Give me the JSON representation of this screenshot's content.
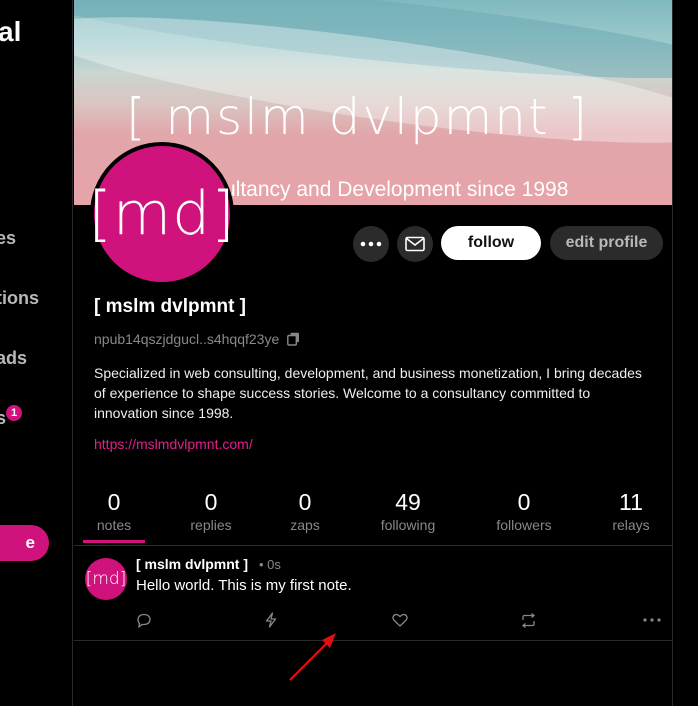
{
  "sidebar": {
    "logo_partial": "al",
    "items": [
      {
        "label": "es"
      },
      {
        "label": "tions"
      },
      {
        "label": "ads"
      },
      {
        "label": "s"
      }
    ],
    "badge_count": "1",
    "post_button_label": "e"
  },
  "banner": {
    "title": "[ mslm dvlpmnt ]",
    "subtitle": "ultancy and Development since 1998"
  },
  "avatar_text": "[md]",
  "actions": {
    "follow_label": "follow",
    "edit_label": "edit profile"
  },
  "profile": {
    "name": "[ mslm dvlpmnt ]",
    "npub": "npub14qszjdgucl..s4hqqf23ye",
    "bio": "Specialized in web consulting, development, and business monetization, I bring decades of experience to shape success stories. Welcome to a consultancy committed to innovation since 1998.",
    "website": "https://mslmdvlpmnt.com/"
  },
  "stats": [
    {
      "value": "0",
      "label": "notes"
    },
    {
      "value": "0",
      "label": "replies"
    },
    {
      "value": "0",
      "label": "zaps"
    },
    {
      "value": "49",
      "label": "following"
    },
    {
      "value": "0",
      "label": "followers"
    },
    {
      "value": "11",
      "label": "relays"
    }
  ],
  "note": {
    "avatar_text": "[md]",
    "author": "[ mslm dvlpmnt ]",
    "time": "• 0s",
    "text": "Hello world. This is my first note."
  },
  "colors": {
    "accent": "#d0137c",
    "link": "#e0208f",
    "annotation_arrow": "#e01010"
  }
}
